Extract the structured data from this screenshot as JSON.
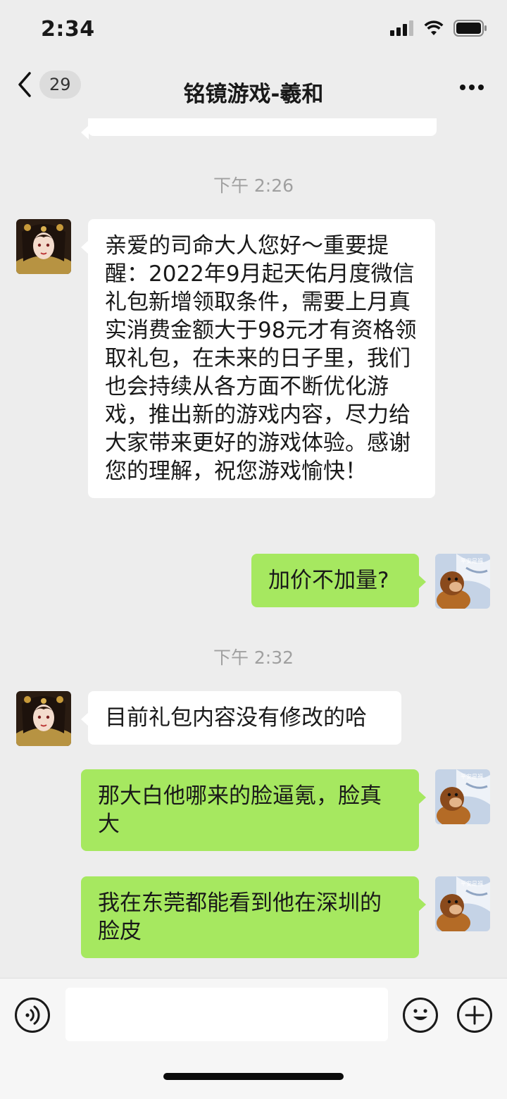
{
  "status_bar": {
    "time": "2:34"
  },
  "nav": {
    "badge": "29",
    "title": "铭镜游戏-羲和"
  },
  "timestamps": [
    "下午 2:26",
    "下午 2:32"
  ],
  "messages": [
    {
      "side": "left",
      "text": "亲爱的司命大人您好～重要提醒：2022年9月起天佑月度微信礼包新增领取条件，需要上月真实消费金额大于98元才有资格领取礼包，在未来的日子里，我们也会持续从各方面不断优化游戏，推出新的游戏内容，尽力给大家带来更好的游戏体验。感谢您的理解，祝您游戏愉快！"
    },
    {
      "side": "right",
      "text": "加价不加量?"
    },
    {
      "side": "left",
      "text": "目前礼包内容没有修改的哈"
    },
    {
      "side": "right",
      "text": "那大白他哪来的脸逼氪，脸真大"
    },
    {
      "side": "right",
      "text": "我在东莞都能看到他在深圳的脸皮"
    }
  ],
  "avatar_labels": {
    "self": "平安是福"
  },
  "colors": {
    "background": "#ededed",
    "bubble_self": "#a6e860",
    "bubble_other": "#ffffff"
  },
  "icons": [
    "back-icon",
    "more-icon",
    "voice-icon",
    "emoji-icon",
    "add-icon",
    "signal-icon",
    "wifi-icon",
    "battery-icon"
  ]
}
